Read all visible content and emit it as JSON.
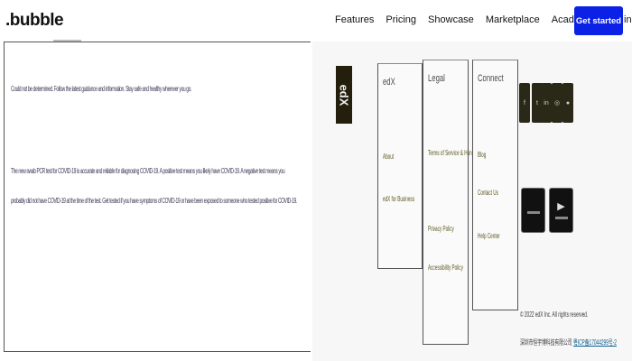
{
  "header": {
    "logo": ".bubble",
    "nav": [
      "Features",
      "Pricing",
      "Showcase",
      "Marketplace",
      "Academy"
    ],
    "login_label": "Log in",
    "cta_label": "Get started",
    "cta_color": "#0b21e6"
  },
  "article": {
    "paragraphs": [
      "Could not be determined. Follow the latest guidance and information. Stay safe and healthy wherever you go.",
      "The new swab PCR test for COVID-19 is accurate and reliable for diagnosing COVID-19. A positive test means you likely have COVID-19. A negative test means you",
      "probably did not have COVID-19 at the time of the test. Get tested if you have symptoms of COVID-19 or have been exposed to someone who tested positive for COVID-19."
    ]
  },
  "footer": {
    "brand_logo": "edX",
    "columns": [
      {
        "title": "edX",
        "links": [
          "About",
          "edX for Business"
        ]
      },
      {
        "title": "Legal",
        "links": [
          "Terms of Service & Honor Code",
          "Privacy Policy",
          "Accessibility Policy"
        ]
      },
      {
        "title": "Connect",
        "links": [
          "Blog",
          "Contact Us",
          "Help Center"
        ]
      }
    ],
    "social_icons": [
      "facebook-icon",
      "twitter-icon",
      "linkedin-icon",
      "instagram-icon",
      "reddit-icon"
    ],
    "app_stores": [
      "App Store",
      "Google Play"
    ],
    "copyright": "© 2022 edX Inc. All rights reserved.",
    "icp_text": "深圳市恒宇博科技有限公司",
    "icp_link": "粤ICP备17044299号-2",
    "link_color": "#5d5a22"
  }
}
